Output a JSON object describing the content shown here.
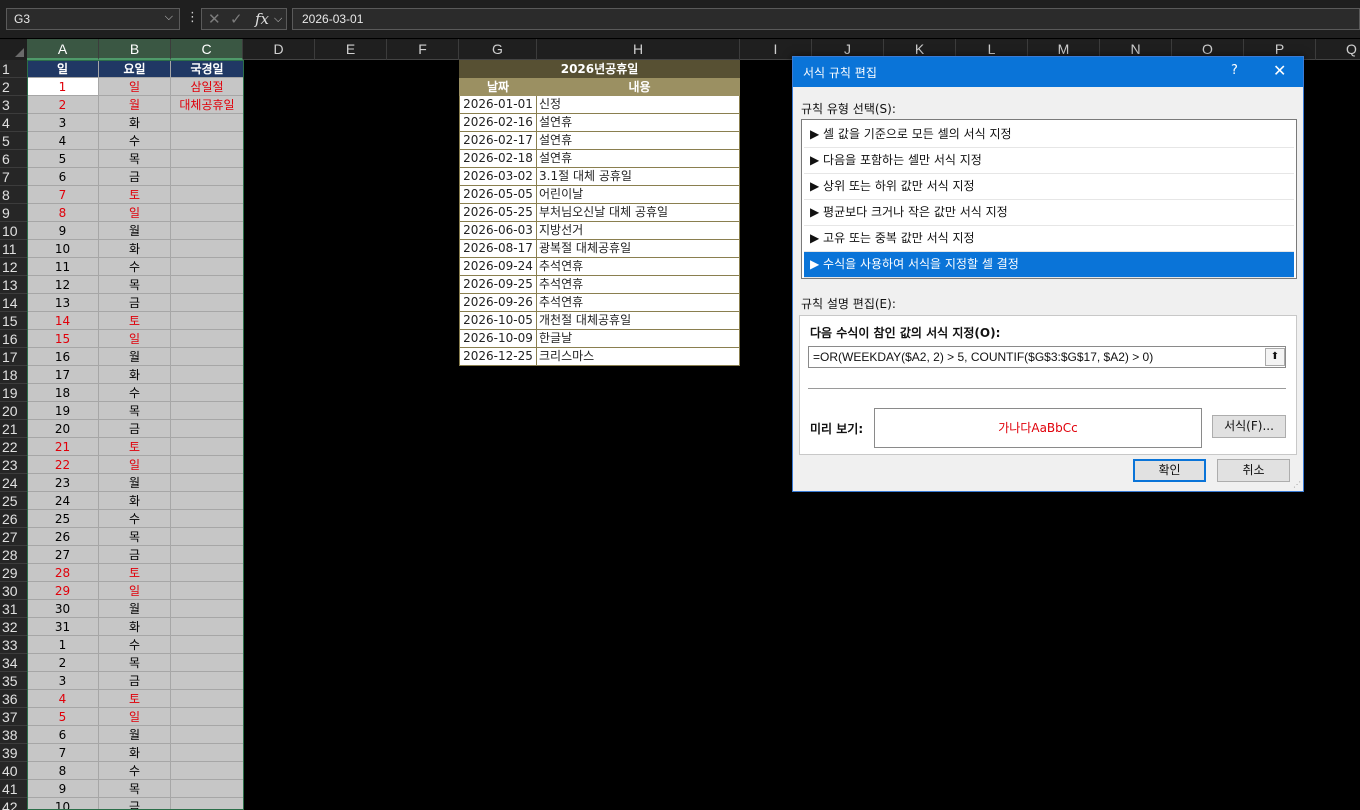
{
  "formula_bar": {
    "name_box": "G3",
    "formula": "2026-03-01"
  },
  "columns": [
    "A",
    "B",
    "C",
    "D",
    "E",
    "F",
    "G",
    "H",
    "I",
    "J",
    "K",
    "L",
    "M",
    "N",
    "O",
    "P",
    "Q"
  ],
  "rows": [
    "1",
    "2",
    "3",
    "4",
    "5",
    "6",
    "7",
    "8",
    "9",
    "10",
    "11",
    "12",
    "13",
    "14",
    "15",
    "16",
    "17",
    "18",
    "19",
    "20",
    "21",
    "22",
    "23",
    "24",
    "25",
    "26",
    "27",
    "28",
    "29",
    "30",
    "31",
    "32",
    "33",
    "34",
    "35",
    "36",
    "37",
    "38",
    "39",
    "40",
    "41",
    "42"
  ],
  "sheet": {
    "headers": [
      "일",
      "요일",
      "국경일"
    ],
    "days": [
      "1",
      "2",
      "3",
      "4",
      "5",
      "6",
      "7",
      "8",
      "9",
      "10",
      "11",
      "12",
      "13",
      "14",
      "15",
      "16",
      "17",
      "18",
      "19",
      "20",
      "21",
      "22",
      "23",
      "24",
      "25",
      "26",
      "27",
      "28",
      "29",
      "30",
      "31",
      "1",
      "2",
      "3",
      "4",
      "5",
      "6",
      "7",
      "8",
      "9",
      "10"
    ],
    "weekdays": [
      "일",
      "월",
      "화",
      "수",
      "목",
      "금",
      "토",
      "일",
      "월",
      "화",
      "수",
      "목",
      "금",
      "토",
      "일",
      "월",
      "화",
      "수",
      "목",
      "금",
      "토",
      "일",
      "월",
      "화",
      "수",
      "목",
      "금",
      "토",
      "일",
      "월",
      "화",
      "수",
      "목",
      "금",
      "토",
      "일",
      "월",
      "화",
      "수",
      "목",
      "금"
    ],
    "holidays_col": [
      "삼일절",
      "대체공휴일"
    ],
    "red_rows": [
      0,
      1,
      6,
      7,
      13,
      14,
      20,
      21,
      27,
      28,
      34,
      35
    ],
    "red_color": "#e0000a"
  },
  "holiday_table": {
    "title": "2026년공휴일",
    "col_date": "날짜",
    "col_desc": "내용",
    "rows": [
      {
        "date": "2026-01-01",
        "desc": "신정"
      },
      {
        "date": "2026-02-16",
        "desc": "설연휴"
      },
      {
        "date": "2026-02-17",
        "desc": "설연휴"
      },
      {
        "date": "2026-02-18",
        "desc": "설연휴"
      },
      {
        "date": "2026-03-02",
        "desc": "3.1절 대체 공휴일"
      },
      {
        "date": "2026-05-05",
        "desc": "어린이날"
      },
      {
        "date": "2026-05-25",
        "desc": "부처님오신날 대체 공휴일"
      },
      {
        "date": "2026-06-03",
        "desc": "지방선거"
      },
      {
        "date": "2026-08-17",
        "desc": "광복절 대체공휴일"
      },
      {
        "date": "2026-09-24",
        "desc": "추석연휴"
      },
      {
        "date": "2026-09-25",
        "desc": "추석연휴"
      },
      {
        "date": "2026-09-26",
        "desc": "추석연휴"
      },
      {
        "date": "2026-10-05",
        "desc": "개천절 대체공휴일"
      },
      {
        "date": "2026-10-09",
        "desc": "한글날"
      },
      {
        "date": "2026-12-25",
        "desc": "크리스마스"
      }
    ]
  },
  "dialog": {
    "title": "서식 규칙 편집",
    "help": "?",
    "close": "✕",
    "rule_type_label": "규칙 유형 선택(S):",
    "rule_types": [
      "▶ 셀 값을 기준으로 모든 셀의 서식 지정",
      "▶ 다음을 포함하는 셀만 서식 지정",
      "▶ 상위 또는 하위 값만 서식 지정",
      "▶ 평균보다 크거나 작은 값만 서식 지정",
      "▶ 고유 또는 중복 값만 서식 지정",
      "▶ 수식을 사용하여 서식을 지정할 셀 결정"
    ],
    "selected_rule_index": 5,
    "desc_label": "규칙 설명 편집(E):",
    "formula_label": "다음 수식이 참인 값의 서식 지정(O):",
    "formula": "=OR(WEEKDAY($A2, 2) > 5, COUNTIF($G$3:$G$17, $A2) > 0)",
    "preview_label": "미리 보기:",
    "preview_text": "가나다AaBbCc",
    "format_button": "서식(F)...",
    "ok_button": "확인",
    "cancel_button": "취소"
  }
}
